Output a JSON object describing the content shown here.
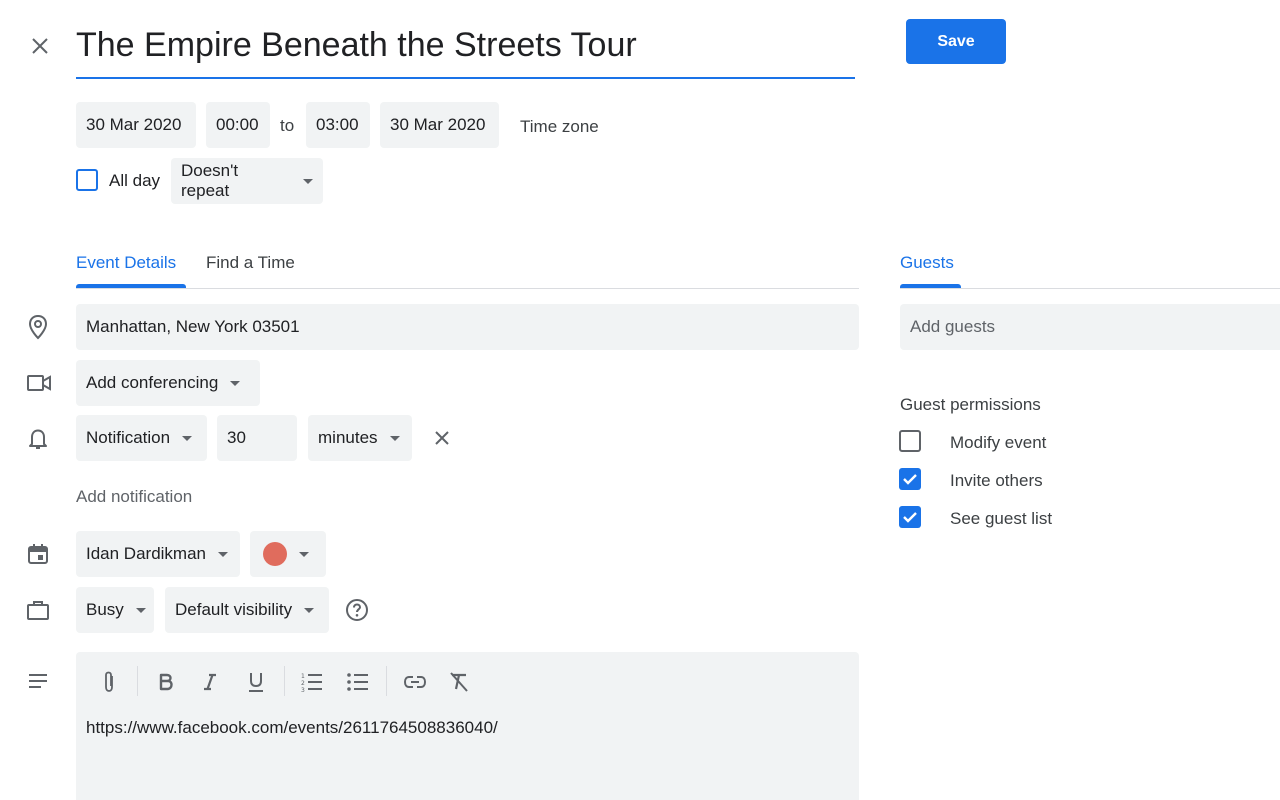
{
  "header": {
    "title": "The Empire Beneath the Streets Tour",
    "save_label": "Save"
  },
  "datetime": {
    "start_date": "30 Mar 2020",
    "start_time": "00:00",
    "to_label": "to",
    "end_time": "03:00",
    "end_date": "30 Mar 2020",
    "timezone_label": "Time zone",
    "all_day_label": "All day",
    "all_day_checked": false,
    "repeat": "Doesn't repeat"
  },
  "tabs": [
    {
      "label": "Event Details",
      "active": true
    },
    {
      "label": "Find a Time",
      "active": false
    }
  ],
  "details": {
    "location": "Manhattan, New York 03501",
    "conferencing": "Add conferencing",
    "notification_type": "Notification",
    "notification_value": "30",
    "notification_unit": "minutes",
    "add_notification": "Add notification",
    "calendar_owner": "Idan Dardikman",
    "event_color": "#e06c5d",
    "availability": "Busy",
    "visibility": "Default visibility",
    "description": "https://www.facebook.com/events/2611764508836040/"
  },
  "guests": {
    "tab_label": "Guests",
    "add_placeholder": "Add guests",
    "permissions_title": "Guest permissions",
    "permissions": [
      {
        "label": "Modify event",
        "checked": false
      },
      {
        "label": "Invite others",
        "checked": true
      },
      {
        "label": "See guest list",
        "checked": true
      }
    ]
  },
  "colors": {
    "accent": "#1a73e8",
    "field_bg": "#f1f3f4",
    "text": "#202124",
    "muted": "#5f6368"
  }
}
